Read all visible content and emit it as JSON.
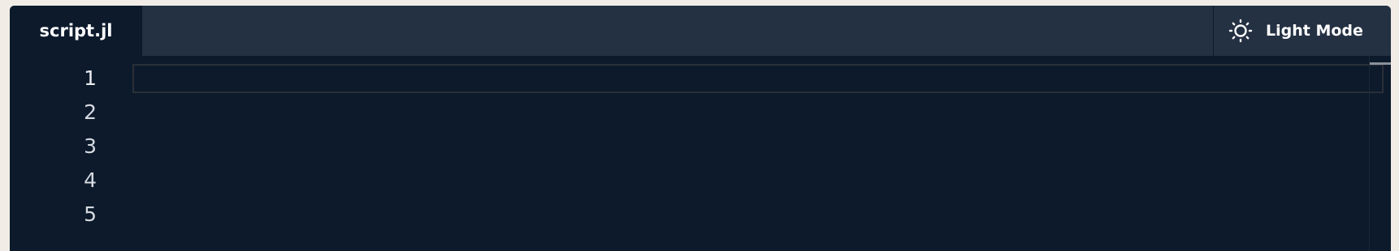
{
  "tabs": [
    {
      "label": "script.jl",
      "active": true
    }
  ],
  "theme_toggle": {
    "label": "Light Mode",
    "icon": "sun-icon"
  },
  "editor": {
    "line_numbers": [
      "1",
      "2",
      "3",
      "4",
      "5"
    ],
    "active_line": 1,
    "content": ""
  },
  "colors": {
    "editor_bg": "#0c1a2c",
    "tabbar_bg": "#243143",
    "text": "#ffffff",
    "page_bg": "#f1ede6"
  }
}
